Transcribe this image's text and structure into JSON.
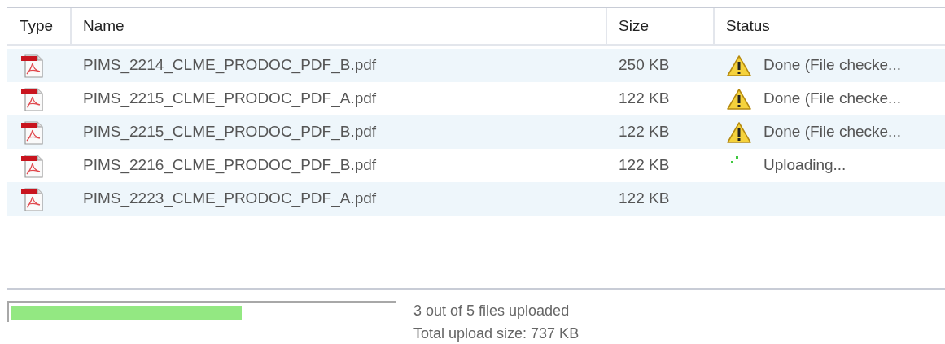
{
  "columns": [
    "Type",
    "Name",
    "Size",
    "Status"
  ],
  "rows": [
    {
      "name": "PIMS_2214_CLME_PRODOC_PDF_B.pdf",
      "size": "250 KB",
      "status": {
        "kind": "warning",
        "text": "Done (File checke..."
      }
    },
    {
      "name": "PIMS_2215_CLME_PRODOC_PDF_A.pdf",
      "size": "122 KB",
      "status": {
        "kind": "warning",
        "text": "Done (File checke..."
      }
    },
    {
      "name": "PIMS_2215_CLME_PRODOC_PDF_B.pdf",
      "size": "122 KB",
      "status": {
        "kind": "warning",
        "text": "Done (File checke..."
      }
    },
    {
      "name": "PIMS_2216_CLME_PRODOC_PDF_B.pdf",
      "size": "122 KB",
      "status": {
        "kind": "uploading",
        "text": "Uploading..."
      }
    },
    {
      "name": "PIMS_2223_CLME_PRODOC_PDF_A.pdf",
      "size": "122 KB"
    }
  ],
  "progress": {
    "level": 0.6,
    "summary": "3 out of 5 files uploaded",
    "total": "Total upload size: 737 KB"
  }
}
